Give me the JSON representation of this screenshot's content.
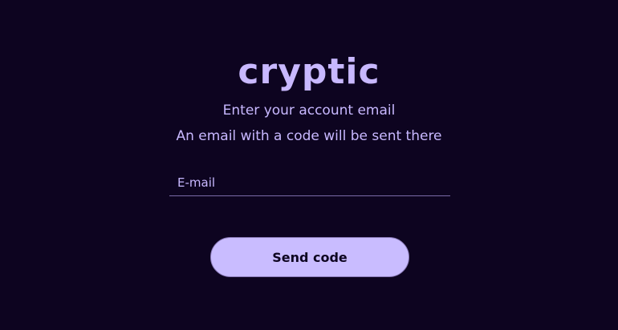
{
  "brand": {
    "logo_text": "cryptic"
  },
  "instructions": {
    "line1": "Enter your account email",
    "line2": "An email with a code will be sent there"
  },
  "email_field": {
    "placeholder": "E-mail",
    "value": ""
  },
  "actions": {
    "send_code_label": "Send code"
  },
  "colors": {
    "background": "#0d0420",
    "accent": "#c8b8ff",
    "button_bg": "#c9bcff",
    "underline": "#7a6aa8"
  }
}
